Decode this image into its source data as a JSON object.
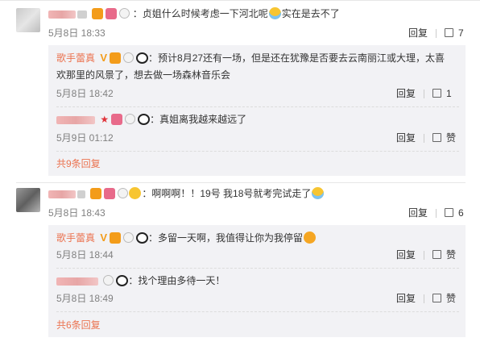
{
  "comments": [
    {
      "text": "：贞姐什么时候考虑一下河北呢",
      "text_tail": "实在是去不了",
      "date": "5月8日 18:33",
      "reply_label": "回复",
      "like_count": "7",
      "replies": [
        {
          "author": "歌手蕾真",
          "text_line1": "：预计8月27还有一场，但是还在犹豫是否要去云南丽江或大理，太喜",
          "text_line2": "欢那里的风景了，想去做一场森林音乐会",
          "date": "5月8日 18:42",
          "reply_label": "回复",
          "like_count": "1"
        },
        {
          "text": "：真姐离我越来越远了",
          "date": "5月9日 01:12",
          "reply_label": "回复",
          "like_label": "赞"
        }
      ],
      "more_label": "共9条回复"
    },
    {
      "text": "：啊啊啊！！19号  我18号就考完试走了",
      "date": "5月8日 18:43",
      "reply_label": "回复",
      "like_count": "6",
      "replies": [
        {
          "author": "歌手蕾真",
          "text": "：多留一天啊，我值得让你为我停留",
          "date": "5月8日 18:44",
          "reply_label": "回复",
          "like_label": "赞"
        },
        {
          "text": "：找个理由多待一天！",
          "date": "5月8日 18:49",
          "reply_label": "回复",
          "like_label": "赞"
        }
      ],
      "more_label": "共6条回复"
    }
  ],
  "colors": {
    "author_accent": "#eb7350",
    "reply_bg": "#f2f2f5",
    "meta_gray": "#808080"
  }
}
